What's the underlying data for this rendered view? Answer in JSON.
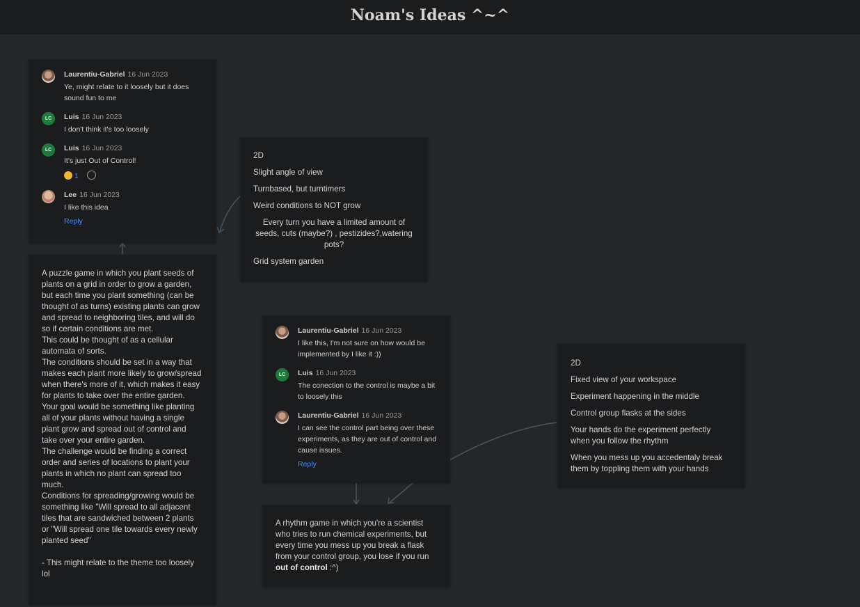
{
  "board": {
    "title": "Noam's Ideas ^~^"
  },
  "thread_a": {
    "comments": [
      {
        "author": "Laurentiu-Gabriel",
        "date": "16 Jun 2023",
        "text": "Ye, might relate to it loosely but it does sound fun to me"
      },
      {
        "author": "Luis",
        "initials": "LC",
        "date": "16 Jun 2023",
        "text": "I don't think it's too loosely"
      },
      {
        "author": "Luis",
        "initials": "LC",
        "date": "16 Jun 2023",
        "text": "It's just Out of Control!",
        "reaction_count": "1"
      },
      {
        "author": "Lee",
        "date": "16 Jun 2023",
        "text": "I like this idea"
      }
    ],
    "reply_label": "Reply"
  },
  "note_garden": {
    "items": [
      "2D",
      "Slight angle of view",
      "Turnbased, but turntimers",
      "Weird conditions to NOT grow",
      "Every turn you have a limited amount of seeds, cuts (maybe?) , pestizides?,watering pots?",
      "Grid system garden"
    ]
  },
  "garden_idea": {
    "lines": [
      "A puzzle game in which you plant seeds of plants on a grid in order to grow a garden, but each time you plant something (can be thought of as turns) existing plants can grow and spread to neighboring tiles, and will do so if certain conditions are met.",
      "This could be thought of as a cellular automata of sorts.",
      "The conditions should be set in a way that makes each plant more likely to grow/spread when there's more of it, which makes it easy for plants to take over the entire garden.",
      "Your goal would be something like planting all of your plants without having a single plant grow and spread out of control and take over your entire garden.",
      "The challenge would be finding a correct order and series of locations to plant your plants in which no plant can spread too much.",
      "Conditions for spreading/growing would be something like \"Will spread to all adjacent tiles that are sandwiched between 2 plants or \"Will spread one tile towards every newly planted seed\"",
      "",
      "- This might relate to the theme too loosely lol"
    ]
  },
  "thread_b": {
    "comments": [
      {
        "author": "Laurentiu-Gabriel",
        "date": "16 Jun 2023",
        "text": "I like this, I'm not sure on how would be implemented by I like it :))"
      },
      {
        "author": "Luis",
        "initials": "LC",
        "date": "16 Jun 2023",
        "text": "The conection to the control is maybe a bit to loosely this"
      },
      {
        "author": "Laurentiu-Gabriel",
        "date": "16 Jun 2023",
        "text": "I can see the control part being over these experiments, as they are out of control and cause issues."
      }
    ],
    "reply_label": "Reply"
  },
  "note_rhythm": {
    "items": [
      "2D",
      "Fixed view of your workspace",
      "Experiment happening in the middle",
      "Control group flasks at the sides",
      "Your hands do the experiment perfectly when you follow the rhythm",
      "When you mess up you accedentaly break them by toppling them with your hands"
    ]
  },
  "rhythm_idea": {
    "text_before": "A rhythm game in which you're a scientist who tries to run chemical experiments, but every time you mess up you break a flask from your control group, you lose if you run ",
    "text_bold": "out of control",
    "text_after": " :^)"
  },
  "colors": {
    "background": "#23272a",
    "card": "#1b1c1e",
    "link": "#4c8df6",
    "avatar_lc": "#1e7a3c"
  }
}
